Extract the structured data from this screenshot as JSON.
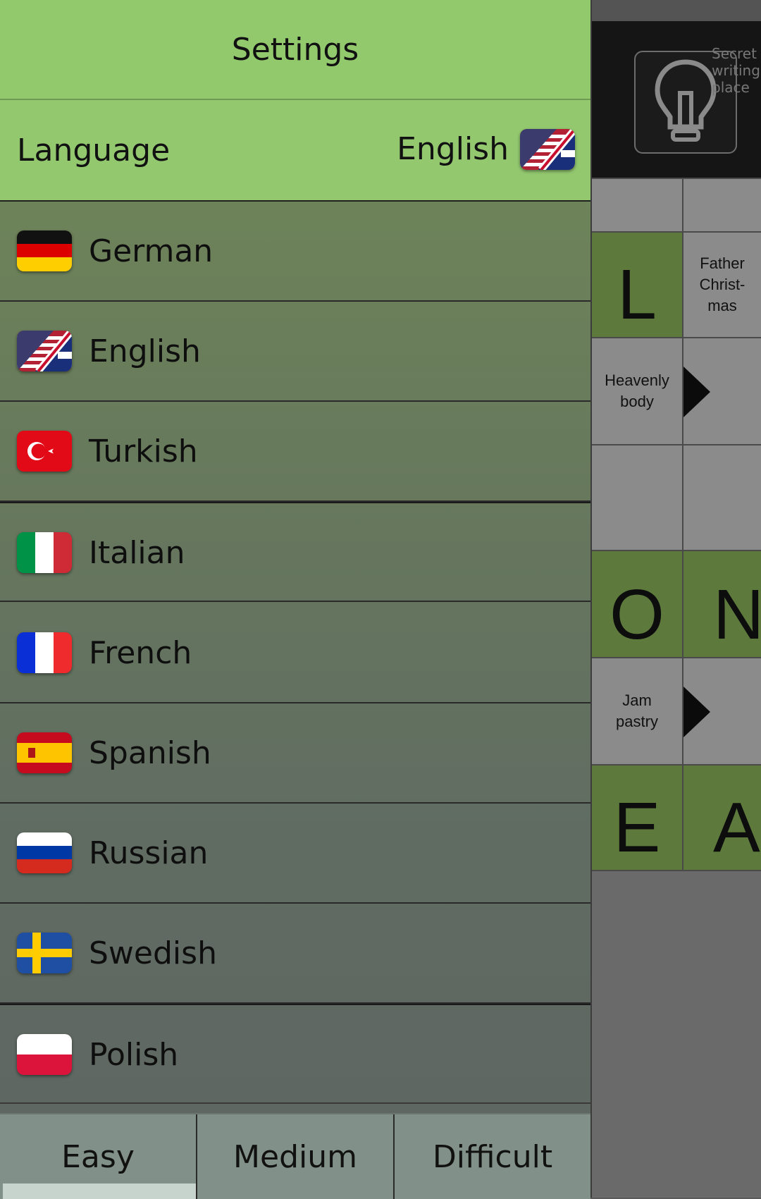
{
  "header": {
    "title": "Settings"
  },
  "language_row": {
    "label": "Language",
    "current": "English",
    "current_flag": "flag-uk-us"
  },
  "languages": [
    {
      "label": "German",
      "flag": "flag-de"
    },
    {
      "label": "English",
      "flag": "flag-uk-us"
    },
    {
      "label": "Turkish",
      "flag": "flag-tr"
    },
    {
      "label": "Italian",
      "flag": "flag-it"
    },
    {
      "label": "French",
      "flag": "flag-fr"
    },
    {
      "label": "Spanish",
      "flag": "flag-es"
    },
    {
      "label": "Russian",
      "flag": "flag-ru"
    },
    {
      "label": "Swedish",
      "flag": "flag-se"
    },
    {
      "label": "Polish",
      "flag": "flag-pl"
    }
  ],
  "difficulty": {
    "tabs": [
      "Easy",
      "Medium",
      "Difficult"
    ],
    "selected": "Easy"
  },
  "board": {
    "letters": [
      "L",
      "O",
      "N",
      "E",
      "A"
    ],
    "clues": [
      "Father Christ-mas",
      "Heavenly body",
      "Jam pastry"
    ],
    "peek_clue": "Secret writing place"
  },
  "colors": {
    "header_green": "#93c96d",
    "cell_green": "#5d7a3c",
    "cell_grey": "#8b8b8b"
  }
}
